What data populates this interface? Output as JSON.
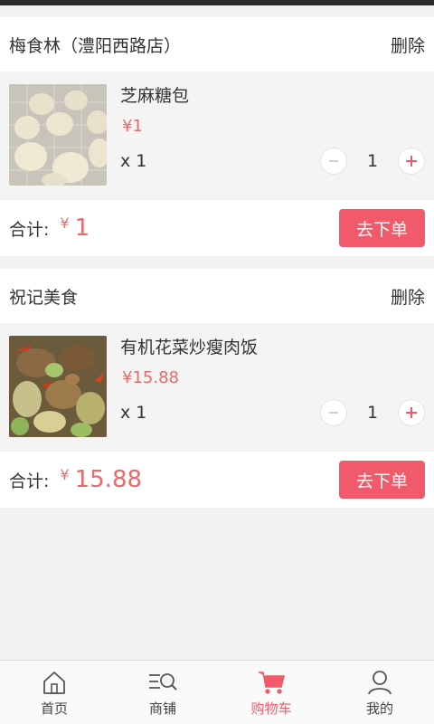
{
  "shops": [
    {
      "name": "梅食林（澧阳西路店）",
      "delete_label": "删除",
      "item": {
        "name": "芝麻糖包",
        "price": "¥1",
        "qty_text": "x 1",
        "qty": "1",
        "image": "steamed-buns-image"
      },
      "total_label": "合计:",
      "currency": "¥",
      "total_amount": "1",
      "order_label": "去下单"
    },
    {
      "name": "祝记美食",
      "delete_label": "删除",
      "item": {
        "name": "有机花菜炒瘦肉饭",
        "price": "¥15.88",
        "qty_text": "x 1",
        "qty": "1",
        "image": "cauliflower-pork-image"
      },
      "total_label": "合计:",
      "currency": "¥",
      "total_amount": "15.88",
      "order_label": "去下单"
    }
  ],
  "tabbar": [
    {
      "label": "首页",
      "icon": "home-icon",
      "active": false
    },
    {
      "label": "商铺",
      "icon": "shop-search-icon",
      "active": false
    },
    {
      "label": "购物车",
      "icon": "cart-icon",
      "active": true
    },
    {
      "label": "我的",
      "icon": "user-icon",
      "active": false
    }
  ],
  "colors": {
    "accent": "#f05a6a",
    "price": "#e86a6a",
    "background": "#f2f2f2"
  }
}
